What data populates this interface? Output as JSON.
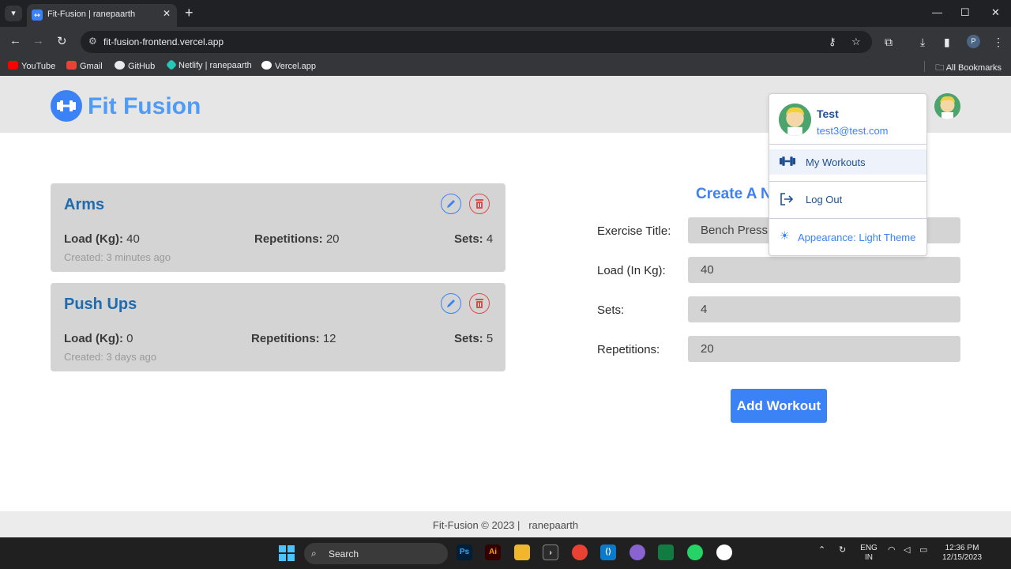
{
  "browser": {
    "tab_title": "Fit-Fusion | ranepaarth",
    "url": "fit-fusion-frontend.vercel.app",
    "bookmarks": [
      {
        "label": "YouTube",
        "color": "#ff0000"
      },
      {
        "label": "Gmail",
        "color": "#ea4335"
      },
      {
        "label": "GitHub",
        "color": "#e8eaed"
      },
      {
        "label": "Netlify | ranepaarth",
        "color": "#25c7b7"
      },
      {
        "label": "Vercel.app",
        "color": "#ffffff"
      }
    ],
    "all_bookmarks_label": "All Bookmarks",
    "profile_initial": "P"
  },
  "app": {
    "brand": "Fit Fusion",
    "accent": "#3b82f6"
  },
  "workouts": [
    {
      "title": "Arms",
      "load_label": "Load (Kg):",
      "load": "40",
      "reps_label": "Repetitions:",
      "reps": "20",
      "sets_label": "Sets:",
      "sets": "4",
      "created": "Created: 3 minutes ago"
    },
    {
      "title": "Push Ups",
      "load_label": "Load (Kg):",
      "load": "0",
      "reps_label": "Repetitions:",
      "reps": "12",
      "sets_label": "Sets:",
      "sets": "5",
      "created": "Created: 3 days ago"
    }
  ],
  "form": {
    "title": "Create A N",
    "exercise_label": "Exercise Title:",
    "exercise_value": "Bench Press",
    "load_label": "Load (In Kg):",
    "load_value": "40",
    "sets_label": "Sets:",
    "sets_value": "4",
    "reps_label": "Repetitions:",
    "reps_value": "20",
    "submit_label": "Add Workout"
  },
  "dropdown": {
    "name": "Test",
    "email": "test3@test.com",
    "my_workouts": "My Workouts",
    "logout": "Log Out",
    "appearance": "Appearance: Light Theme"
  },
  "footer": {
    "text": "Fit-Fusion © 2023 |   ranepaarth"
  },
  "taskbar": {
    "search_label": "Search",
    "lang_top": "ENG",
    "lang_bottom": "IN",
    "time": "12:36 PM",
    "date": "12/15/2023"
  }
}
